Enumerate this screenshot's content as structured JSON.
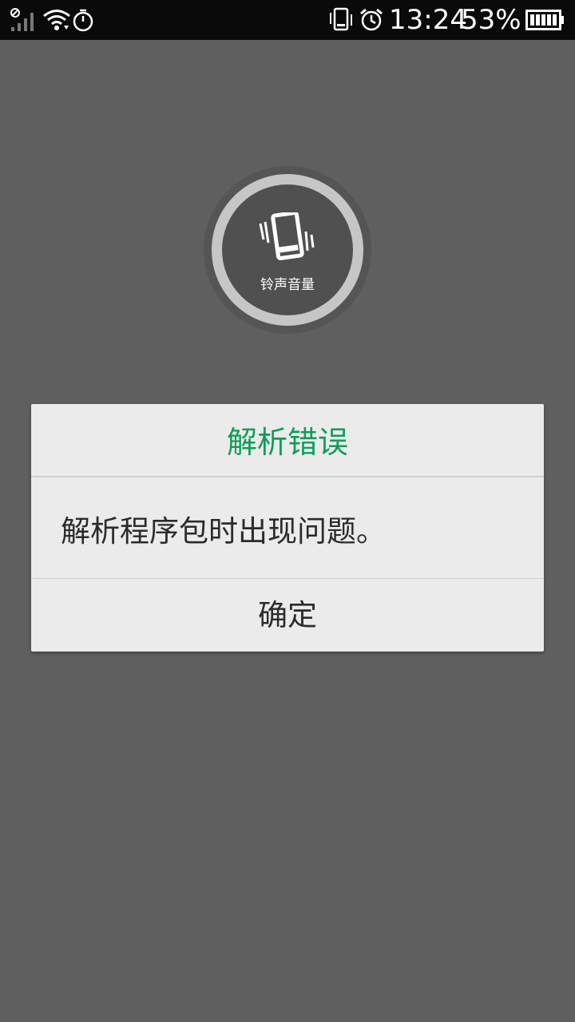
{
  "status_bar": {
    "time": "13:24",
    "battery_percent": "53%",
    "battery_level": 0.53,
    "icons": [
      "no-sim-signal-icon",
      "wifi-icon",
      "timer-icon",
      "vibrate-icon",
      "alarm-icon",
      "battery-icon"
    ]
  },
  "volume_panel": {
    "label": "铃声音量",
    "icon": "vibrate-phone-icon"
  },
  "dialog": {
    "title": "解析错误",
    "message": "解析程序包时出现问题。",
    "ok_label": "确定",
    "accent_color": "#0f9d58"
  }
}
